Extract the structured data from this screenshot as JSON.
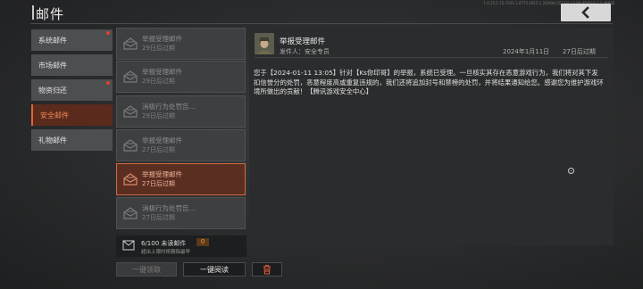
{
  "header": {
    "title": "邮件",
    "status_text": "1.0.15.1.15.1501.1.0773.2615.1 2026年1月11日 12:00 4月02日 1.5.超高清"
  },
  "categories": [
    {
      "label": "系统邮件",
      "has_dot": true
    },
    {
      "label": "市场邮件",
      "has_dot": false
    },
    {
      "label": "物资归还",
      "has_dot": true
    },
    {
      "label": "安全邮件",
      "selected": true
    },
    {
      "label": "礼物邮件",
      "has_dot": false
    }
  ],
  "mails": [
    {
      "title": "举报受理邮件",
      "expiry": "29日后过期"
    },
    {
      "title": "举报受理邮件",
      "expiry": "29日后过期"
    },
    {
      "title": "消极行为处罚告...",
      "expiry": "29日后过期"
    },
    {
      "title": "举报受理邮件",
      "expiry": "27日后过期"
    },
    {
      "title": "举报受理邮件",
      "expiry": "27日后过期",
      "selected": true
    },
    {
      "title": "消极行为处罚告...",
      "expiry": "27日后过期"
    }
  ],
  "unread": {
    "count_text": "6/100 未读邮件",
    "badge": "0",
    "note": "超出上限时将删除最早"
  },
  "buttons": {
    "claim": "一键领取",
    "read": "一键阅读"
  },
  "detail": {
    "title": "举报受理邮件",
    "sender": "发件人：安全专员",
    "date": "2024年1月11日",
    "expiry": "27日后过期",
    "body": "您于【2024-01-11 13:05】针对【Ks你印哥】的举报，系统已受理。一旦核实其存在恶意游戏行为，我们将对其下发扣信誉分的处罚，恶意程度高或重复违规的，我们还将追加封号和禁榜的处罚，并将结果通知给您。感谢您为维护游戏环境所做出的贡献！【腾讯游戏安全中心】"
  },
  "colors": {
    "accent": "#e0643a",
    "selected_bg": "#5a2a1c",
    "dot": "#e0432a"
  }
}
